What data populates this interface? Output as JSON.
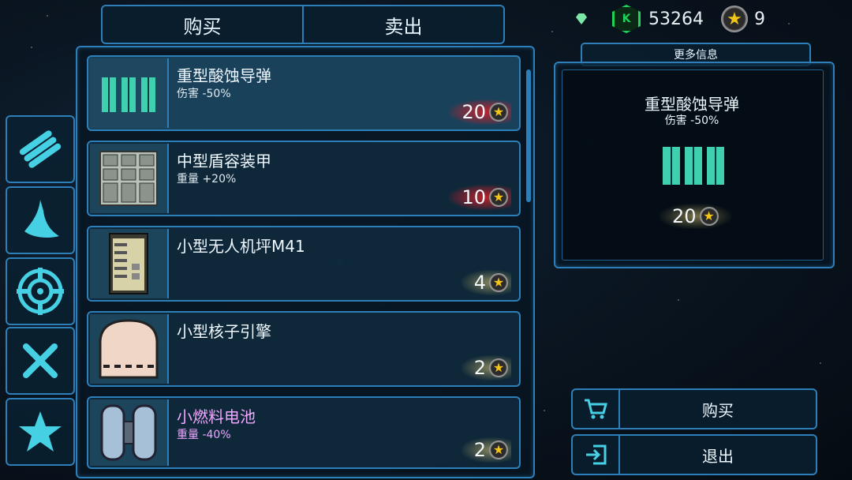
{
  "tabs": [
    {
      "label": "购买",
      "active": true
    },
    {
      "label": "卖出",
      "active": false
    }
  ],
  "currency": {
    "credits": "53264",
    "stars": "9",
    "credits_color": "#1fd35a",
    "star_color": "#f3c514"
  },
  "categories": [
    {
      "icon": "missile-bundle-icon"
    },
    {
      "icon": "armor-icon"
    },
    {
      "icon": "target-icon"
    },
    {
      "icon": "tools-icon"
    },
    {
      "icon": "star-icon"
    }
  ],
  "items": [
    {
      "name": "重型酸蚀导弹",
      "stat": "伤害 -50%",
      "price": "20",
      "price_glow": "red",
      "icon": "missile-pack-icon",
      "selected": true
    },
    {
      "name": "中型盾容装甲",
      "stat": "重量 +20%",
      "price": "10",
      "price_glow": "red",
      "icon": "armor-plates-icon"
    },
    {
      "name": "小型无人机坪M41",
      "stat": "",
      "price": "4",
      "price_glow": "gold",
      "icon": "drone-bay-icon"
    },
    {
      "name": "小型核子引擎",
      "stat": "",
      "price": "2",
      "price_glow": "gold",
      "icon": "engine-icon"
    },
    {
      "name": "小燃料电池",
      "stat": "重量 -40%",
      "price": "2",
      "price_glow": "gold",
      "icon": "fuel-cell-icon",
      "name_color": "#f0a8ff"
    }
  ],
  "info": {
    "header": "更多信息",
    "title": "重型酸蚀导弹",
    "stat": "伤害 -50%",
    "price": "20",
    "icon": "missile-pack-icon"
  },
  "actions": {
    "buy_label": "购买",
    "exit_label": "退出"
  }
}
